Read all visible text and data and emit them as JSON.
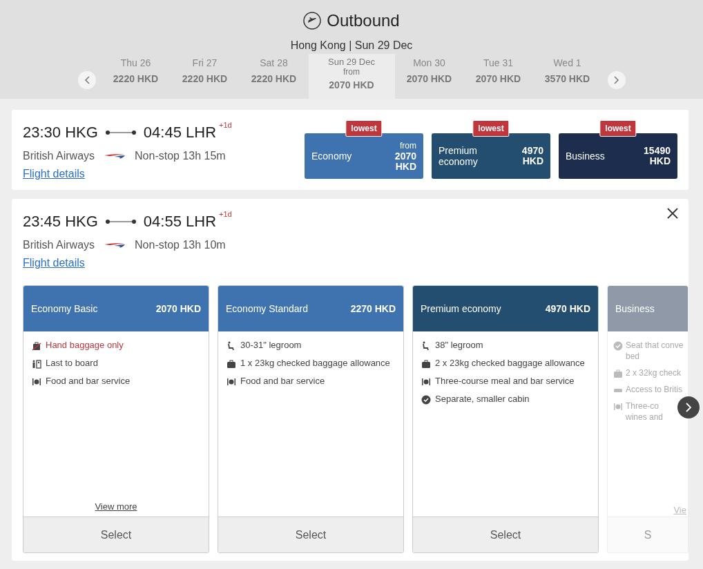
{
  "header": {
    "title": "Outbound",
    "subtitle": "Hong Kong | Sun 29 Dec"
  },
  "dates": [
    {
      "day": "Thu 26",
      "price": "2220 HKD",
      "selected": false
    },
    {
      "day": "Fri 27",
      "price": "2220 HKD",
      "selected": false
    },
    {
      "day": "Sat 28",
      "price": "2220 HKD",
      "selected": false
    },
    {
      "day": "Sun 29 Dec",
      "from": "from",
      "price": "2070 HKD",
      "selected": true
    },
    {
      "day": "Mon 30",
      "price": "2070 HKD",
      "selected": false
    },
    {
      "day": "Tue 31",
      "price": "2070 HKD",
      "selected": false
    },
    {
      "day": "Wed 1",
      "price": "3570 HKD",
      "selected": false
    }
  ],
  "flights": [
    {
      "depart": "23:30 HKG",
      "arrive": "04:45 LHR",
      "plus_day": "+1d",
      "airline": "British Airways",
      "duration": "Non-stop 13h 15m",
      "details": "Flight details",
      "expanded": false,
      "fares": [
        {
          "badge": "lowest",
          "cabin": "Economy",
          "from": "from",
          "price": "2070",
          "currency": "HKD",
          "color": "#3f73b0"
        },
        {
          "badge": "lowest",
          "cabin": "Premium economy",
          "price": "4970",
          "currency": "HKD",
          "color": "#234e70"
        },
        {
          "badge": "lowest",
          "cabin": "Business",
          "price": "15490",
          "currency": "HKD",
          "color": "#1d2d4d"
        }
      ]
    },
    {
      "depart": "23:45 HKG",
      "arrive": "04:55 LHR",
      "plus_day": "+1d",
      "airline": "British Airways",
      "duration": "Non-stop 13h 10m",
      "details": "Flight details",
      "expanded": true,
      "options": [
        {
          "name": "Economy Basic",
          "price": "2070 HKD",
          "color": "#3f73b0",
          "disabled": false,
          "features": [
            {
              "kind": "nobag",
              "text": "Hand baggage only",
              "warning": true
            },
            {
              "kind": "board",
              "text": "Last to board",
              "warning": false
            },
            {
              "kind": "food",
              "text": "Food and bar service",
              "warning": false
            }
          ],
          "more": "View more",
          "button": "Select"
        },
        {
          "name": "Economy Standard",
          "price": "2270 HKD",
          "color": "#3f73b0",
          "disabled": false,
          "features": [
            {
              "kind": "seat",
              "text": "30-31\" legroom",
              "warning": false
            },
            {
              "kind": "bag",
              "text": "1 x 23kg checked baggage allowance",
              "warning": false
            },
            {
              "kind": "food",
              "text": "Food and bar service",
              "warning": false
            }
          ],
          "button": "Select"
        },
        {
          "name": "Premium economy",
          "price": "4970 HKD",
          "color": "#234e70",
          "disabled": false,
          "features": [
            {
              "kind": "seat",
              "text": "38\" legroom",
              "warning": false
            },
            {
              "kind": "bag",
              "text": "2 x 23kg checked baggage allowance",
              "warning": false
            },
            {
              "kind": "food",
              "text": "Three-course meal and bar service",
              "warning": false
            },
            {
              "kind": "check",
              "text": "Separate, smaller cabin",
              "warning": false
            }
          ],
          "button": "Select"
        },
        {
          "name": "Business",
          "color": "#8f99a8",
          "disabled": true,
          "features": [
            {
              "kind": "check",
              "text": "Seat that conve\nbed",
              "warning": false
            },
            {
              "kind": "bag",
              "text": "2 x 32kg check",
              "warning": false
            },
            {
              "kind": "lounge",
              "text": "Access to Britis",
              "warning": false
            },
            {
              "kind": "food",
              "text": "Three-co\nwines and",
              "warning": false
            }
          ],
          "more": "Vie",
          "button": "S"
        }
      ]
    }
  ]
}
